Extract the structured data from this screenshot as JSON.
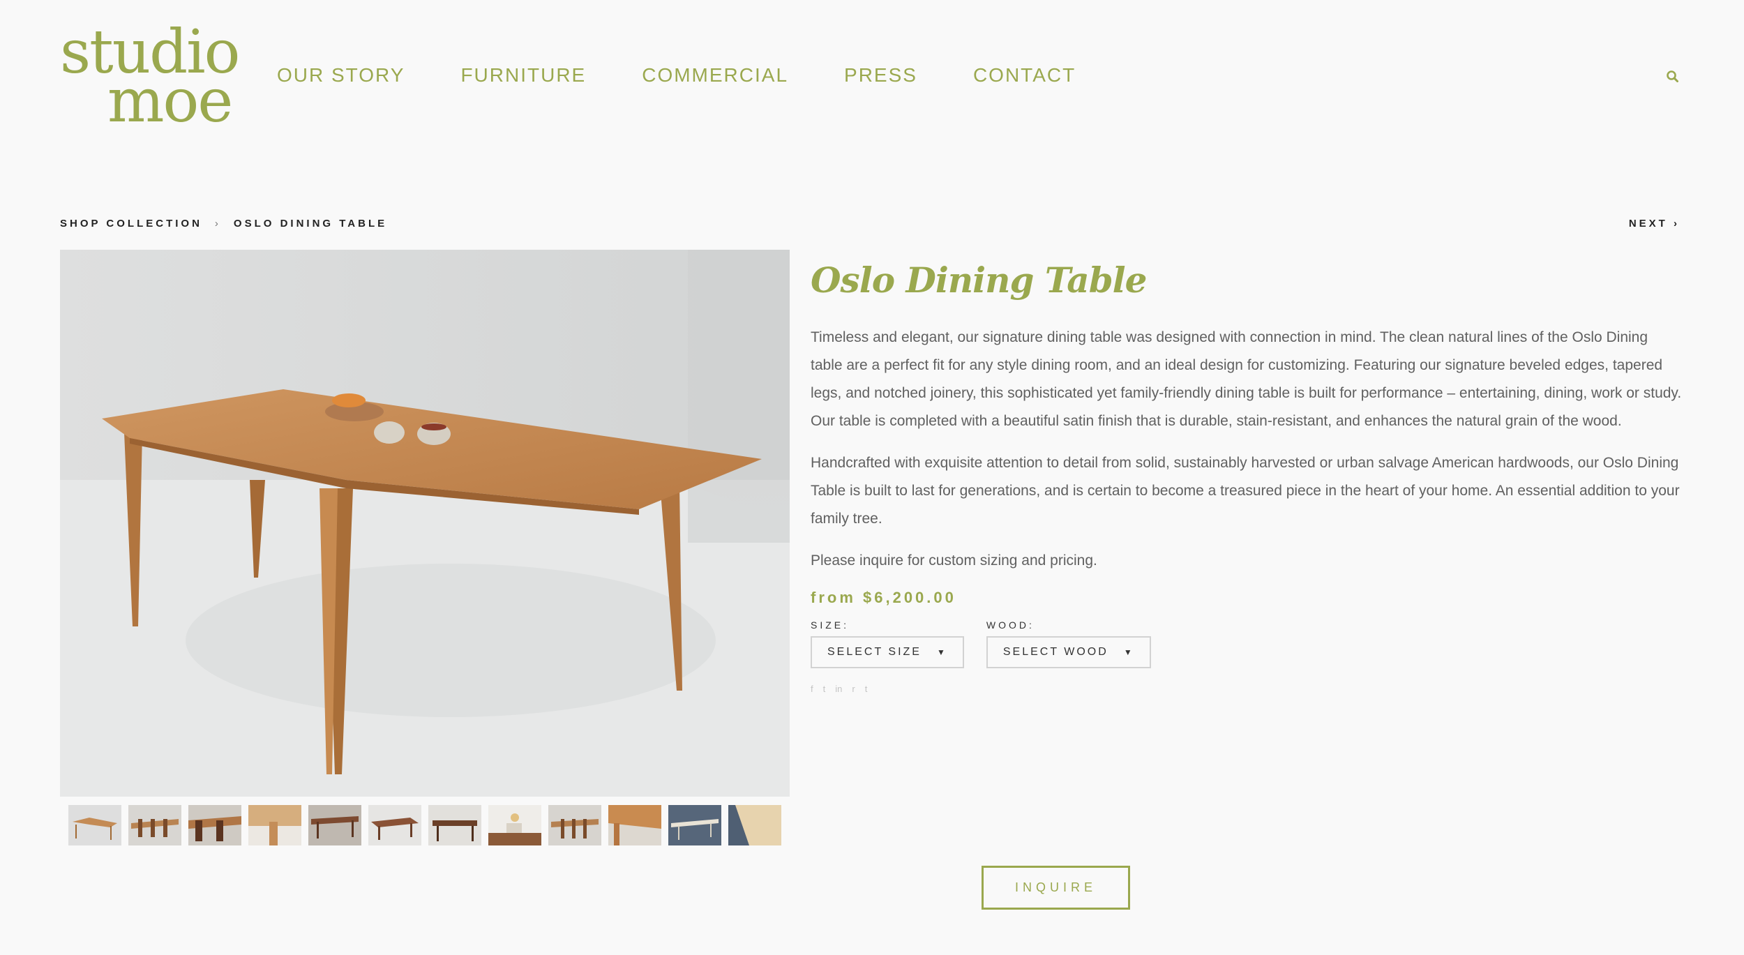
{
  "brand": {
    "line1": "studio",
    "line2": "moe"
  },
  "nav": [
    "OUR STORY",
    "FURNITURE",
    "COMMERCIAL",
    "PRESS",
    "CONTACT"
  ],
  "breadcrumb": {
    "parent": "SHOP COLLECTION",
    "separator": "›",
    "current": "OSLO DINING TABLE"
  },
  "next_label": "NEXT ›",
  "product": {
    "title": "Oslo Dining Table",
    "description_1": "Timeless and elegant, our signature dining table was designed with connection in mind. The clean natural lines of the Oslo Dining table are a perfect fit for any style dining room, and an ideal design for customizing. Featuring our signature beveled edges, tapered legs, and notched joinery, this sophisticated yet family-friendly dining table is built for performance – entertaining, dining, work or study.  Our table is completed with a beautiful satin finish that is durable, stain-resistant, and enhances the natural grain of the wood.",
    "description_2": "Handcrafted with exquisite attention to detail from solid, sustainably harvested or urban salvage American hardwoods, our Oslo Dining Table is built to last for generations, and is certain to become a treasured piece in the heart of your home.  An essential addition to your family tree.",
    "description_3": "Please inquire for custom sizing and pricing.",
    "price": "from $6,200.00",
    "size": {
      "label": "SIZE:",
      "value": "SELECT SIZE"
    },
    "wood": {
      "label": "WOOD:",
      "value": "SELECT WOOD"
    }
  },
  "social_icons": [
    "f",
    "t",
    "in",
    "r",
    "t"
  ],
  "inquire_label": "INQUIRE",
  "colors": {
    "accent": "#9aa84e",
    "background": "#f9f9f9"
  }
}
